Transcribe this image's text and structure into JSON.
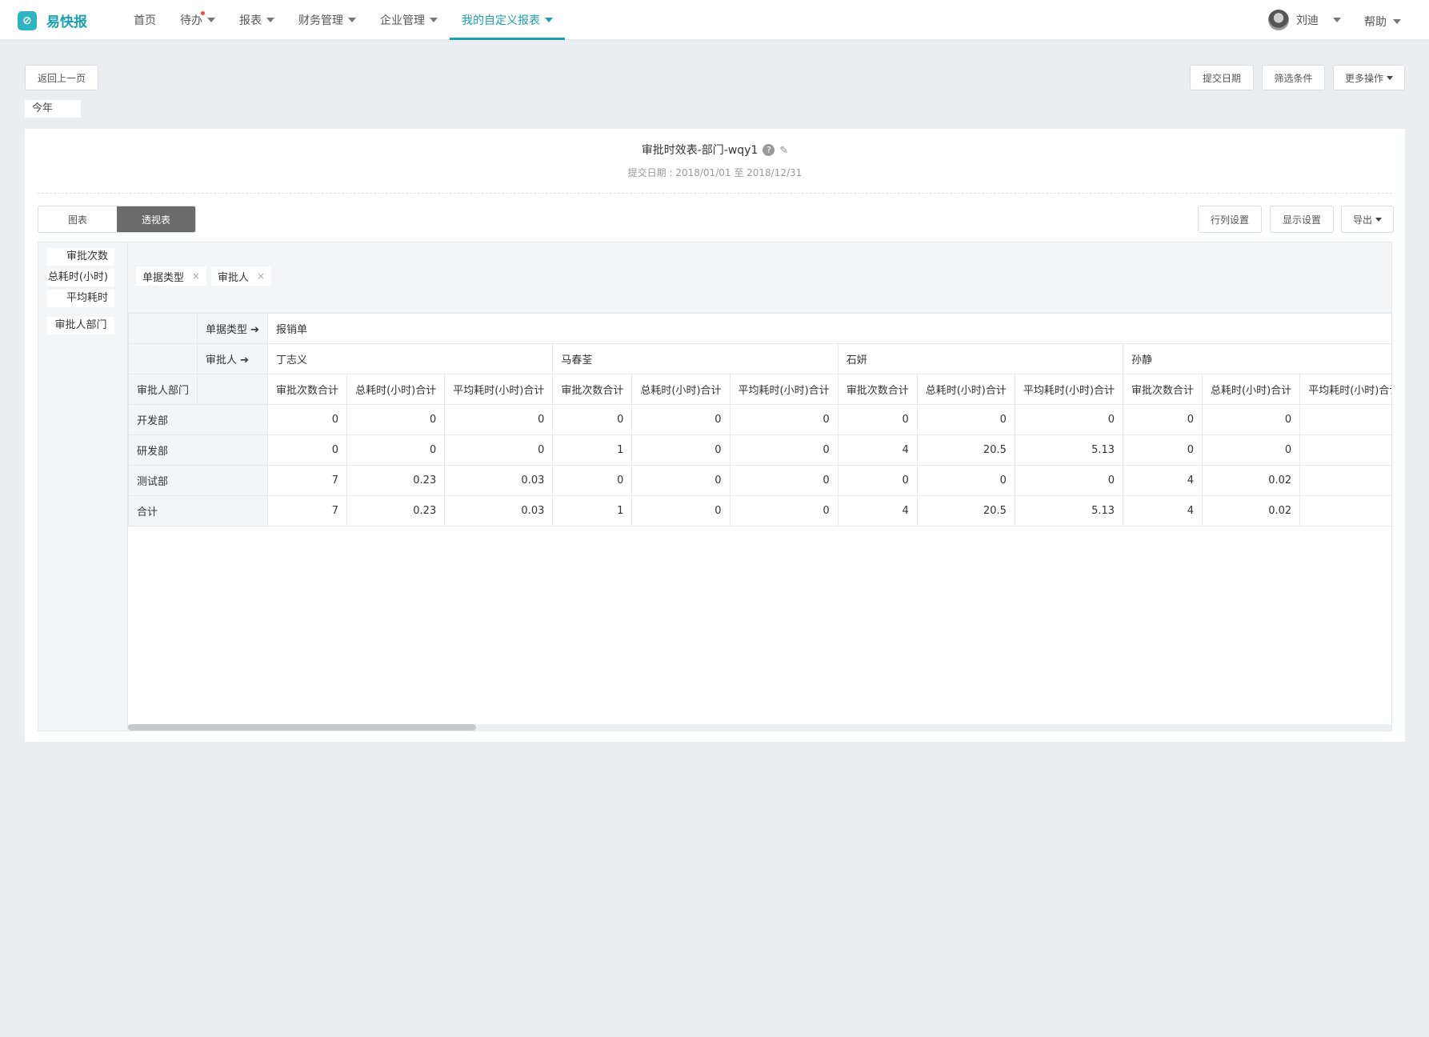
{
  "app": {
    "logo_glyph": "⊘",
    "name": "易快报",
    "accent": "#1aa0ae"
  },
  "nav": {
    "home": "首页",
    "todo": "待办",
    "reports": "报表",
    "finance": "财务管理",
    "enterprise": "企业管理",
    "custom_reports": "我的自定义报表"
  },
  "user": {
    "name": "刘迪"
  },
  "help": "帮助",
  "toolbar": {
    "back": "返回上一页",
    "submit_date": "提交日期",
    "filters": "筛选条件",
    "more": "更多操作",
    "period_tag": "今年"
  },
  "report": {
    "title": "审批时效表-部门-wqy1",
    "help_glyph": "?",
    "edit_glyph": "✎",
    "subtitle": "提交日期 : 2018/01/01 至 2018/12/31"
  },
  "view_tabs": {
    "chart": "图表",
    "pivot": "透视表"
  },
  "actions": {
    "row_col": "行列设置",
    "display": "显示设置",
    "export": "导出"
  },
  "pivot": {
    "measures": [
      "审批次数",
      "总耗时(小时)",
      "平均耗时"
    ],
    "row_field": "审批人部门",
    "col_chips": [
      "单据类型",
      "审批人"
    ],
    "chip_close": "×",
    "header_doc_type_label": "单据类型 ➔",
    "doc_type_value": "报销单",
    "header_approver_label": "审批人 ➔",
    "approvers": [
      "丁志义",
      "马春荃",
      "石妍",
      "孙静"
    ],
    "row_header": "审批人部门",
    "measure_cols": [
      "审批次数合计",
      "总耗时(小时)合计",
      "平均耗时(小时)合计"
    ],
    "rows": [
      {
        "dept": "开发部",
        "values": [
          "0",
          "0",
          "0",
          "0",
          "0",
          "0",
          "0",
          "0",
          "0",
          "0",
          "0",
          ""
        ]
      },
      {
        "dept": "研发部",
        "values": [
          "0",
          "0",
          "0",
          "1",
          "0",
          "0",
          "4",
          "20.5",
          "5.13",
          "0",
          "0",
          ""
        ]
      },
      {
        "dept": "测试部",
        "values": [
          "7",
          "0.23",
          "0.03",
          "0",
          "0",
          "0",
          "0",
          "0",
          "0",
          "4",
          "0.02",
          ""
        ]
      },
      {
        "dept": "合计",
        "values": [
          "7",
          "0.23",
          "0.03",
          "1",
          "0",
          "0",
          "4",
          "20.5",
          "5.13",
          "4",
          "0.02",
          ""
        ]
      }
    ]
  }
}
